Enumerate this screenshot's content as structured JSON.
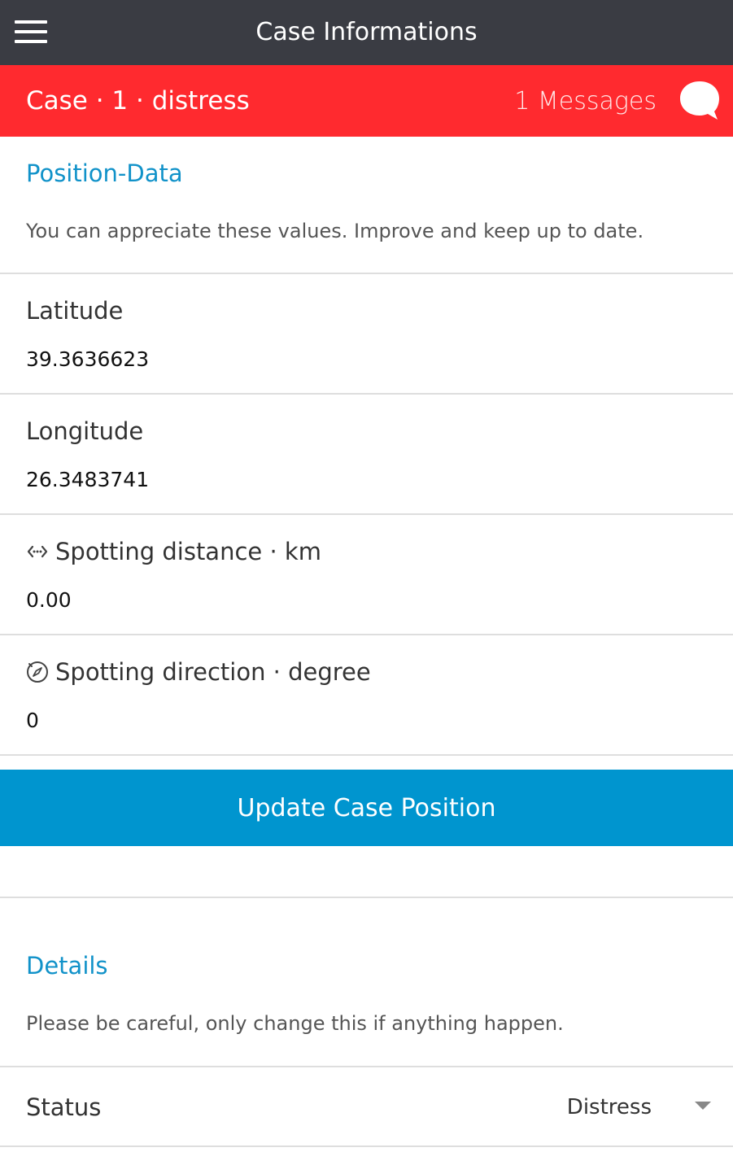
{
  "header": {
    "title": "Case Informations",
    "menu_icon": "hamburger-menu-icon"
  },
  "case_bar": {
    "title": "Case · 1 · distress",
    "messages_label": "1 Messages",
    "messages_icon": "chat-bubble-icon",
    "background_color": "#ff2a2f"
  },
  "position_section": {
    "title": "Position-Data",
    "description": "You can appreciate these values. Improve and keep up to date.",
    "fields": [
      {
        "label": "Latitude",
        "value": "39.3636623"
      },
      {
        "label": "Longitude",
        "value": "26.3483741"
      },
      {
        "label": "Spotting distance · km",
        "value": "0.00",
        "icon": "distance-arrows-icon"
      },
      {
        "label": "Spotting direction · degree",
        "value": "0",
        "icon": "compass-icon"
      }
    ],
    "update_button_label": "Update Case Position",
    "button_color": "#0095cf"
  },
  "details_section": {
    "title": "Details",
    "description": "Please be careful, only change this if anything happen.",
    "status_label": "Status",
    "status_value": "Distress"
  }
}
